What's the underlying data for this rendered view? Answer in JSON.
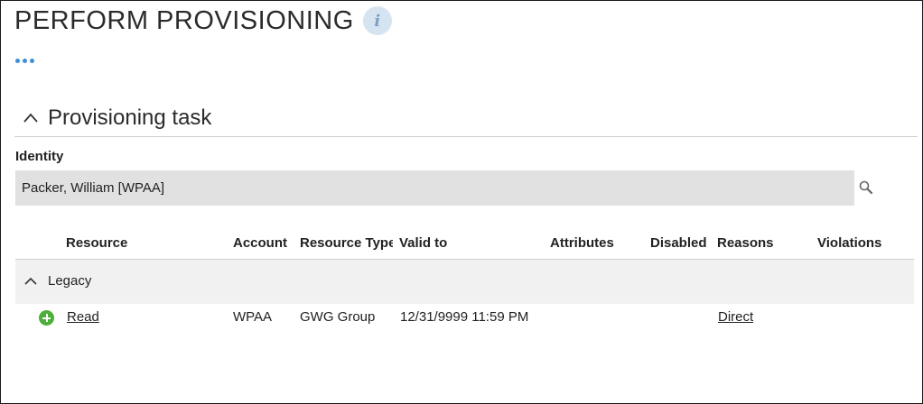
{
  "page": {
    "title": "PERFORM PROVISIONING",
    "info_icon": "info-icon",
    "more_icon": "more-dots-icon",
    "accent_color": "#3d8fd8"
  },
  "section": {
    "title": "Provisioning task",
    "toggle_icon": "chevron-up-icon"
  },
  "identity": {
    "label": "Identity",
    "value": "Packer, William [WPAA]",
    "search_icon": "search-icon"
  },
  "table": {
    "columns": [
      "Resource",
      "Account",
      "Resource Type",
      "Valid to",
      "Attributes",
      "Disabled",
      "Reasons",
      "Violations"
    ],
    "groups": [
      {
        "label": "Legacy",
        "toggle_icon": "chevron-up-icon",
        "rows": [
          {
            "action_icon": "add-circle-icon",
            "resource": "Read",
            "account": "WPAA",
            "resource_type": "GWG Group",
            "valid_to": "12/31/9999 11:59 PM",
            "attributes": "",
            "disabled": "",
            "reasons": "Direct",
            "violations": ""
          }
        ]
      }
    ]
  }
}
